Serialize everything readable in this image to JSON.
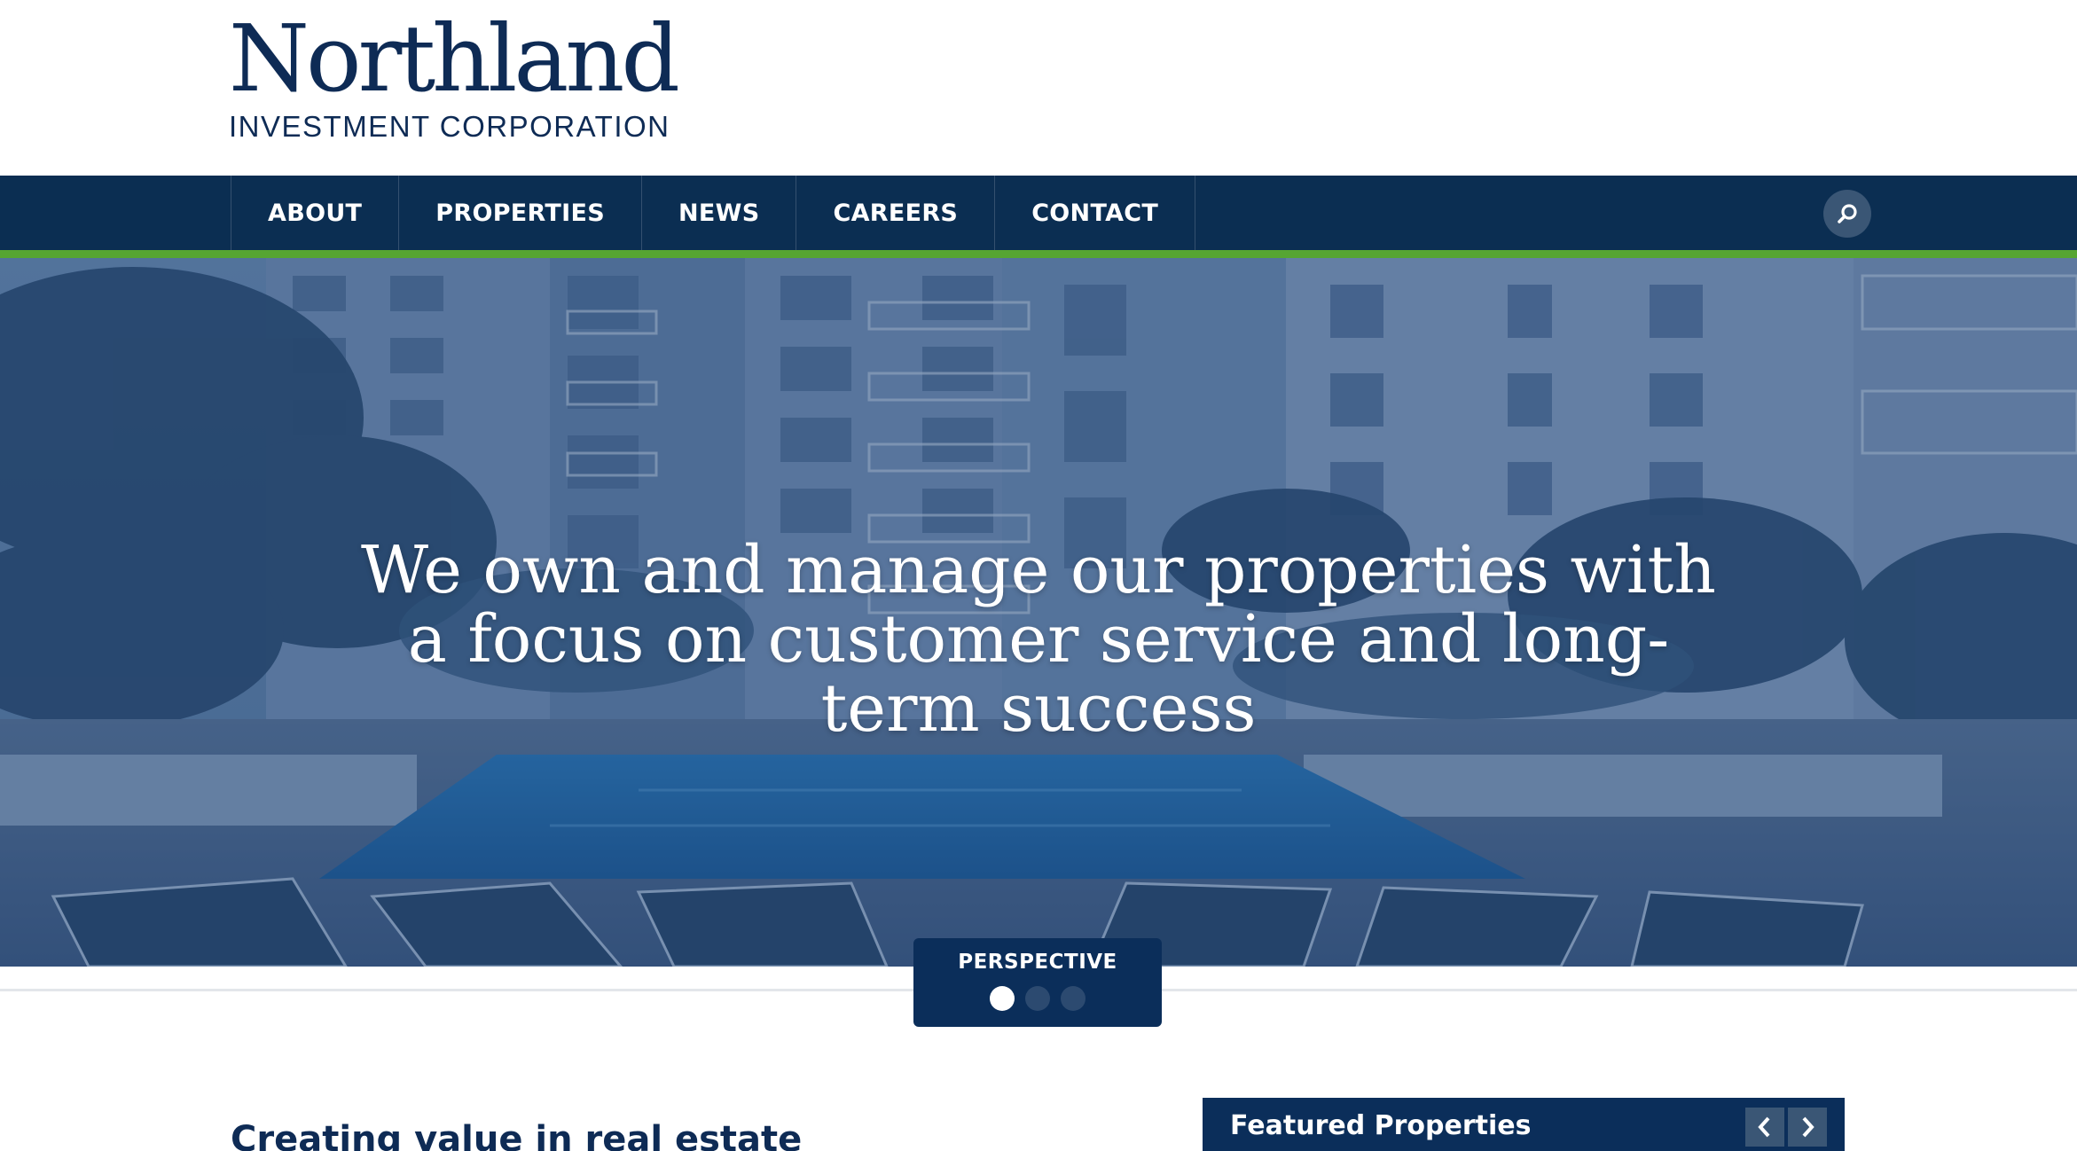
{
  "brand": {
    "name": "Northland",
    "tagline": "INVESTMENT CORPORATION"
  },
  "nav": {
    "items": [
      {
        "label": "ABOUT"
      },
      {
        "label": "PROPERTIES"
      },
      {
        "label": "NEWS"
      },
      {
        "label": "CAREERS"
      },
      {
        "label": "CONTACT"
      }
    ],
    "search_icon": "search-icon"
  },
  "hero": {
    "headline": "We own and manage our properties with a focus on customer service and long-term success",
    "slide_label": "PERSPECTIVE",
    "slide_count": 3,
    "active_slide": 1
  },
  "intro": {
    "heading": "Creating value in real estate"
  },
  "featured": {
    "title": "Featured Properties",
    "prev_icon": "chevron-left-icon",
    "next_icon": "chevron-right-icon"
  },
  "colors": {
    "brand_navy": "#0e2b55",
    "nav_bg": "#0b2e52",
    "accent_green": "#56a532"
  }
}
